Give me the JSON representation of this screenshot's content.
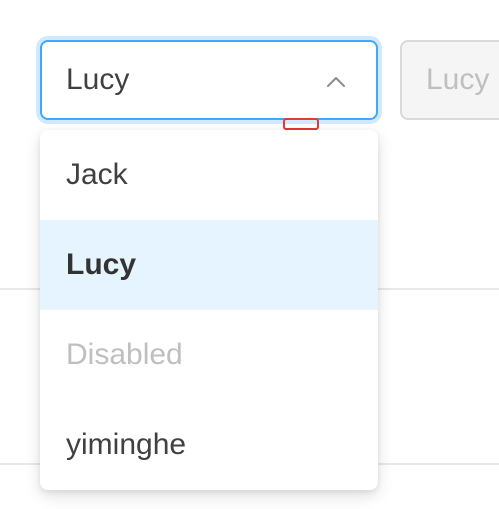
{
  "select": {
    "value": "Lucy",
    "open": true,
    "arrow_icon": "chevron-up-icon"
  },
  "disabled_select": {
    "value": "Lucy"
  },
  "options": [
    {
      "label": "Jack",
      "state": "normal"
    },
    {
      "label": "Lucy",
      "state": "selected"
    },
    {
      "label": "Disabled",
      "state": "disabled"
    },
    {
      "label": "yiminghe",
      "state": "normal"
    }
  ],
  "colors": {
    "focus_border": "#40a9ff",
    "selected_bg": "#e6f4ff",
    "disabled_text": "#bfbfbf",
    "marker": "#e53935"
  }
}
